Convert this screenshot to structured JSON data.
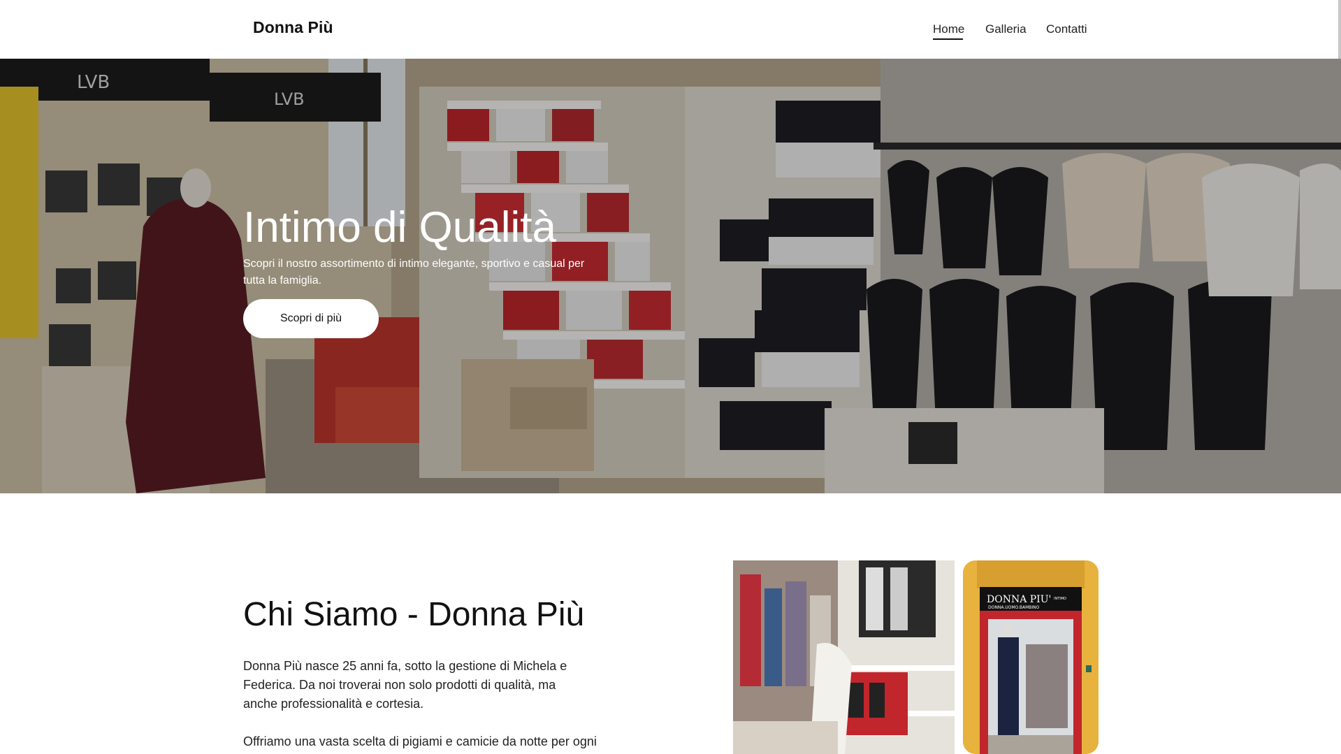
{
  "header": {
    "brand": "Donna Più",
    "nav": [
      {
        "label": "Home",
        "active": true
      },
      {
        "label": "Galleria",
        "active": false
      },
      {
        "label": "Contatti",
        "active": false
      }
    ]
  },
  "hero": {
    "title": "Intimo di Qualità",
    "subtitle": "Scopri il nostro assortimento di intimo elegante, sportivo e casual per tutta la famiglia.",
    "button_label": "Scopri di più",
    "store_signs": [
      "LVB",
      "LVB"
    ]
  },
  "about": {
    "title": "Chi Siamo - Donna Più",
    "paragraph1": "Donna Più nasce 25 anni fa, sotto la gestione di Michela e Federica. Da noi troverai non solo prodotti di qualità, ma anche professionalità e cortesia.",
    "paragraph2": "Offriamo una vasta scelta di pigiami e camicie da notte per ogni",
    "storefront_sign": "DONNA PIU'",
    "storefront_subsign": "DONNA.UOMO.BAMBINO",
    "storefront_tag": "INTIMO"
  },
  "colors": {
    "accent": "#111111",
    "button_bg": "#ffffff",
    "storefront_wall": "#e7b23d",
    "storefront_red": "#c0262c"
  }
}
